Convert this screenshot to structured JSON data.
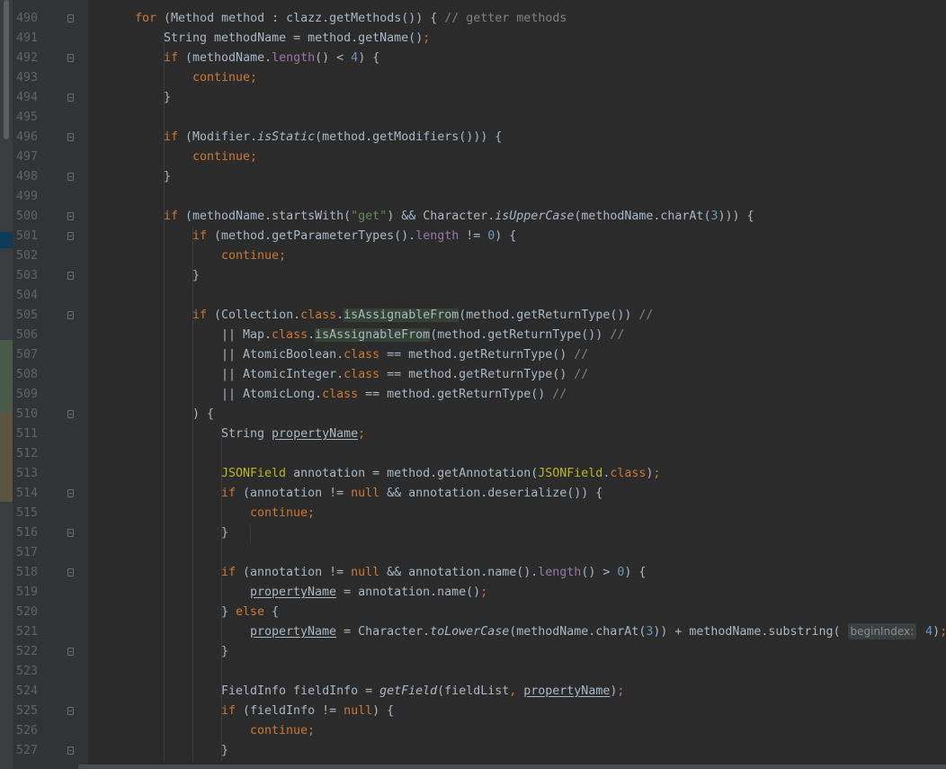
{
  "editor": {
    "language": "Java",
    "colors": {
      "background": "#2b2b2b",
      "gutter": "#313335",
      "keyword": "#cc7832",
      "string": "#6a8759",
      "number": "#6897bb",
      "comment": "#808080",
      "field": "#9876aa",
      "annotation": "#bbb529",
      "identifier": "#a9b7c6"
    },
    "lines": [
      {
        "n": "490",
        "t": "for (Method method : clazz.getMethods()) { // getter methods"
      },
      {
        "n": "491",
        "t": "String methodName = method.getName();"
      },
      {
        "n": "492",
        "t": "if (methodName.length() < 4) {"
      },
      {
        "n": "493",
        "t": "continue;"
      },
      {
        "n": "494",
        "t": "}"
      },
      {
        "n": "495",
        "t": ""
      },
      {
        "n": "496",
        "t": "if (Modifier.isStatic(method.getModifiers())) {"
      },
      {
        "n": "497",
        "t": "continue;"
      },
      {
        "n": "498",
        "t": "}"
      },
      {
        "n": "499",
        "t": ""
      },
      {
        "n": "500",
        "t": "if (methodName.startsWith(\"get\") && Character.isUpperCase(methodName.charAt(3))) {"
      },
      {
        "n": "501",
        "t": "if (method.getParameterTypes().length != 0) {"
      },
      {
        "n": "502",
        "t": "continue;"
      },
      {
        "n": "503",
        "t": "}"
      },
      {
        "n": "504",
        "t": ""
      },
      {
        "n": "505",
        "t": "if (Collection.class.isAssignableFrom(method.getReturnType()) //"
      },
      {
        "n": "506",
        "t": "|| Map.class.isAssignableFrom(method.getReturnType()) //"
      },
      {
        "n": "507",
        "t": "|| AtomicBoolean.class == method.getReturnType() //"
      },
      {
        "n": "508",
        "t": "|| AtomicInteger.class == method.getReturnType() //"
      },
      {
        "n": "509",
        "t": "|| AtomicLong.class == method.getReturnType() //"
      },
      {
        "n": "510",
        "t": ") {"
      },
      {
        "n": "511",
        "t": "String propertyName;"
      },
      {
        "n": "512",
        "t": ""
      },
      {
        "n": "513",
        "t": "JSONField annotation = method.getAnnotation(JSONField.class);"
      },
      {
        "n": "514",
        "t": "if (annotation != null && annotation.deserialize()) {"
      },
      {
        "n": "515",
        "t": "continue;"
      },
      {
        "n": "516",
        "t": "}"
      },
      {
        "n": "517",
        "t": ""
      },
      {
        "n": "518",
        "t": "if (annotation != null && annotation.name().length() > 0) {"
      },
      {
        "n": "519",
        "t": "propertyName = annotation.name();"
      },
      {
        "n": "520",
        "t": "} else {"
      },
      {
        "n": "521",
        "t": "propertyName = Character.toLowerCase(methodName.charAt(3)) + methodName.substring( beginIndex: 4);"
      },
      {
        "n": "522",
        "t": "}"
      },
      {
        "n": "523",
        "t": ""
      },
      {
        "n": "524",
        "t": "FieldInfo fieldInfo = getField(fieldList, propertyName);"
      },
      {
        "n": "525",
        "t": "if (fieldInfo != null) {"
      },
      {
        "n": "526",
        "t": "continue;"
      },
      {
        "n": "527",
        "t": "}"
      }
    ],
    "param_hint": "beginIndex:"
  }
}
